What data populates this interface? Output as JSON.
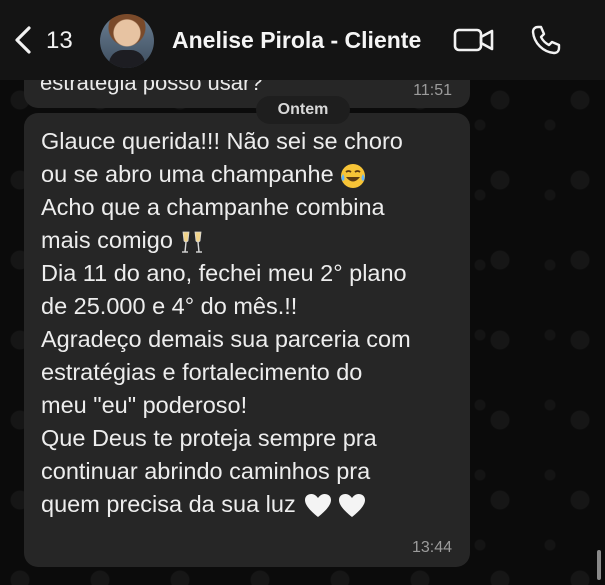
{
  "header": {
    "back_count": "13",
    "contact_name": "Anelise Pirola - Cliente",
    "icons": [
      "chevron-left-icon",
      "video-call-icon",
      "phone-icon"
    ]
  },
  "previous_message": {
    "text": "estrategia posso usar?",
    "time": "11:51"
  },
  "date_separator": "Ontem",
  "message": {
    "lines": [
      "Glauce querida!!! Não sei se choro",
      "ou se abro uma champanhe",
      "Acho que a champanhe combina",
      "mais comigo",
      "Dia 11 do ano, fechei meu 2° plano",
      "de 25.000 e 4° do mês.!!",
      "Agradeço demais sua parceria com",
      "estratégias e fortalecimento do",
      "meu \"eu\" poderoso!",
      "Que Deus te proteja sempre pra",
      "continuar abrindo caminhos pra",
      "quem precisa da sua luz"
    ],
    "emojis": [
      "laughing-tears-emoji",
      "champagne-glasses-emoji",
      "white-heart-emoji",
      "white-heart-emoji"
    ],
    "time": "13:44"
  },
  "colors": {
    "background": "#0b0b0b",
    "header": "#141414",
    "bubble": "#262626",
    "timestamp": "#9b9b9b"
  }
}
